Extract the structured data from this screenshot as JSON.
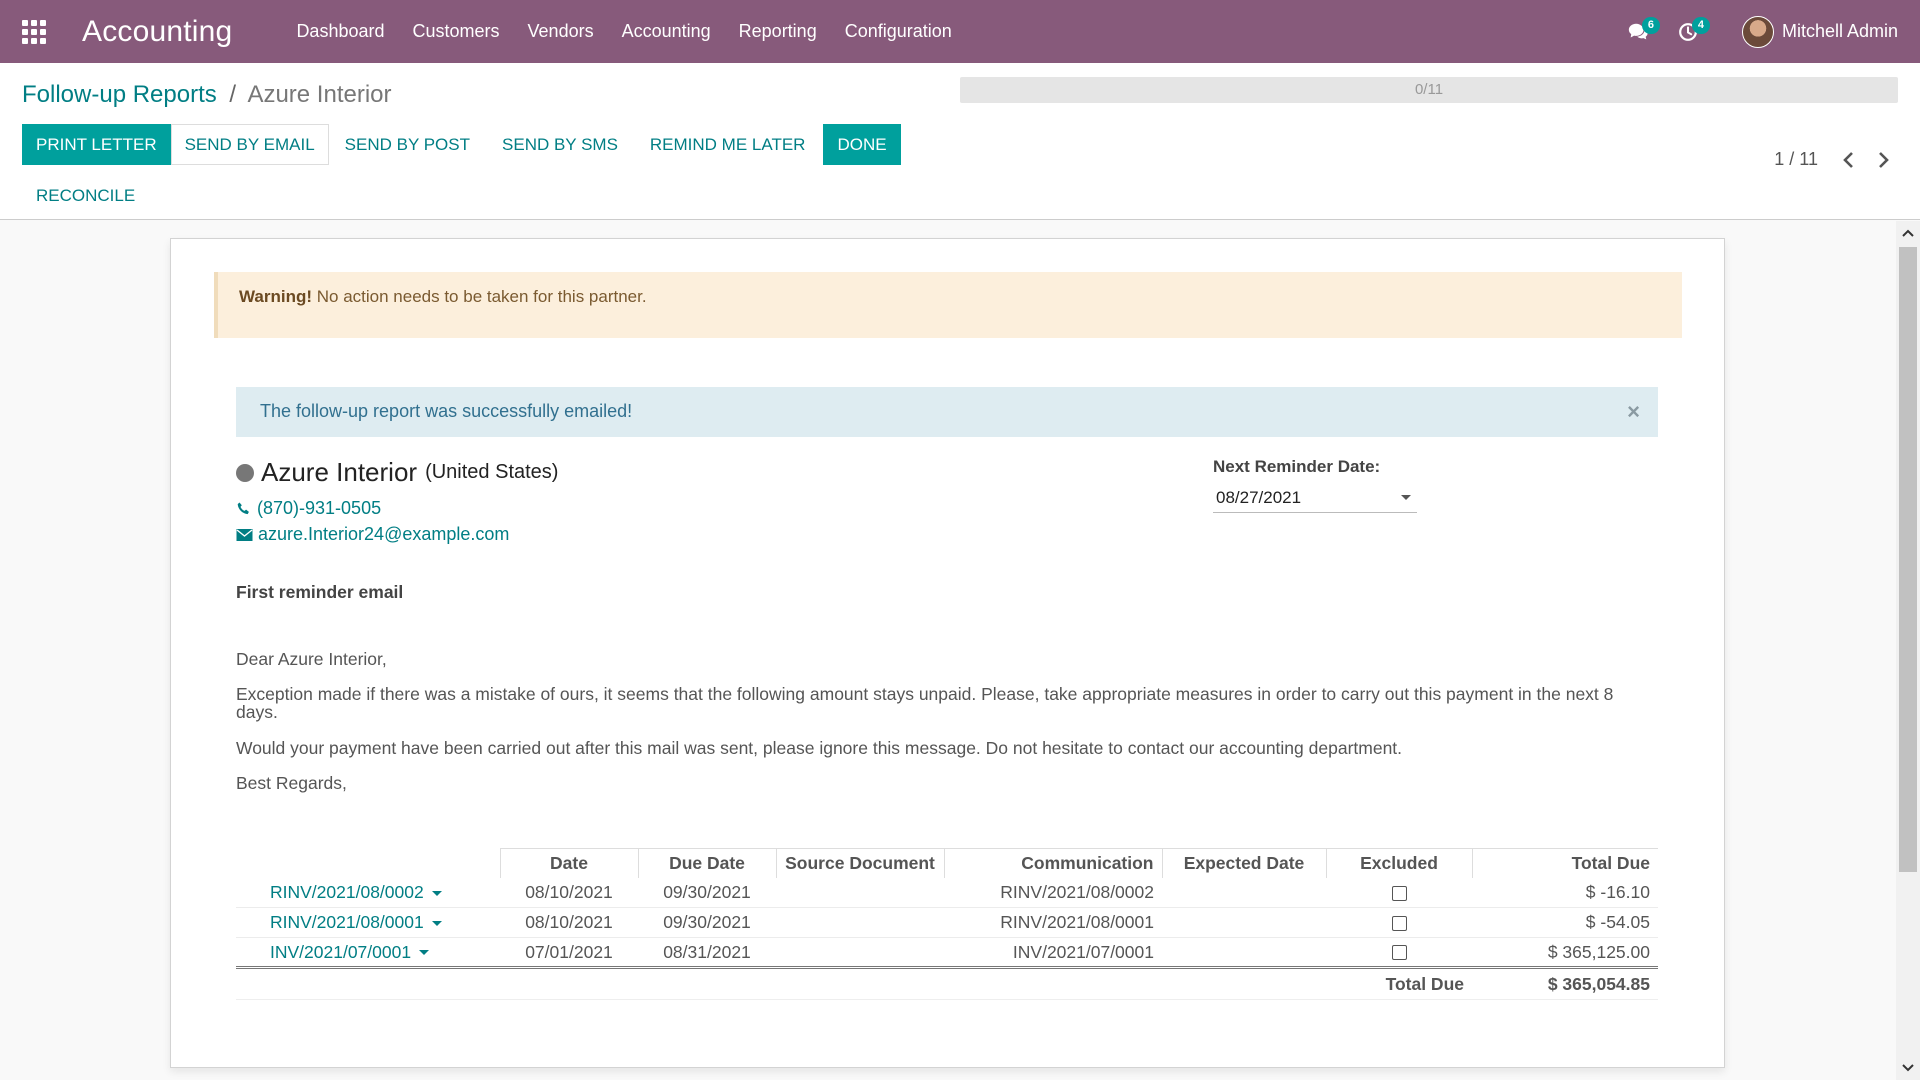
{
  "app": {
    "brand": "Accounting",
    "menu": [
      "Dashboard",
      "Customers",
      "Vendors",
      "Accounting",
      "Reporting",
      "Configuration"
    ],
    "messages_count": "6",
    "activities_count": "4",
    "user_name": "Mitchell Admin"
  },
  "breadcrumb": {
    "parent": "Follow-up Reports",
    "separator": "/",
    "current": "Azure Interior"
  },
  "progress": {
    "label": "0/11",
    "value": 0
  },
  "toolbar": {
    "print_letter": "PRINT LETTER",
    "send_email": "SEND BY EMAIL",
    "send_post": "SEND BY POST",
    "send_sms": "SEND BY SMS",
    "remind_later": "REMIND ME LATER",
    "done": "DONE",
    "reconcile": "RECONCILE"
  },
  "pager": {
    "label": "1 / 11"
  },
  "warning": {
    "strong": "Warning!",
    "text": " No action needs to be taken for this partner."
  },
  "alert": {
    "text": "The follow-up report was successfully emailed!",
    "close": "×"
  },
  "partner": {
    "name": "Azure Interior",
    "country": "(United States)",
    "phone": "(870)-931-0505",
    "email": "azure.Interior24@example.com"
  },
  "reminder": {
    "label": "Next Reminder Date:",
    "value": "08/27/2021"
  },
  "letter": {
    "subject": "First reminder email",
    "greeting": "Dear Azure Interior,",
    "para1": "Exception made if there was a mistake of ours, it seems that the following amount stays unpaid. Please, take appropriate measures in order to carry out this payment in the next 8 days.",
    "para2": "Would your payment have been carried out after this mail was sent, please ignore this message. Do not hesitate to contact our accounting department.",
    "closing": "Best Regards,"
  },
  "table": {
    "headers": [
      "Date",
      "Due Date",
      "Source Document",
      "Communication",
      "Expected Date",
      "Excluded",
      "Total Due"
    ],
    "rows": [
      {
        "ref": "RINV/2021/08/0002",
        "date": "08/10/2021",
        "due": "09/30/2021",
        "source": "",
        "comm": "RINV/2021/08/0002",
        "expected": "",
        "excluded": false,
        "total": "$ -16.10"
      },
      {
        "ref": "RINV/2021/08/0001",
        "date": "08/10/2021",
        "due": "09/30/2021",
        "source": "",
        "comm": "RINV/2021/08/0001",
        "expected": "",
        "excluded": false,
        "total": "$ -54.05"
      },
      {
        "ref": "INV/2021/07/0001",
        "date": "07/01/2021",
        "due": "08/31/2021",
        "source": "",
        "comm": "INV/2021/07/0001",
        "expected": "",
        "excluded": false,
        "total": "$ 365,125.00"
      }
    ],
    "total_label": "Total Due",
    "total_value": "$ 365,054.85"
  },
  "colors": {
    "topbar": "#875a7b",
    "accent": "#00a09d",
    "link": "#017e84"
  }
}
